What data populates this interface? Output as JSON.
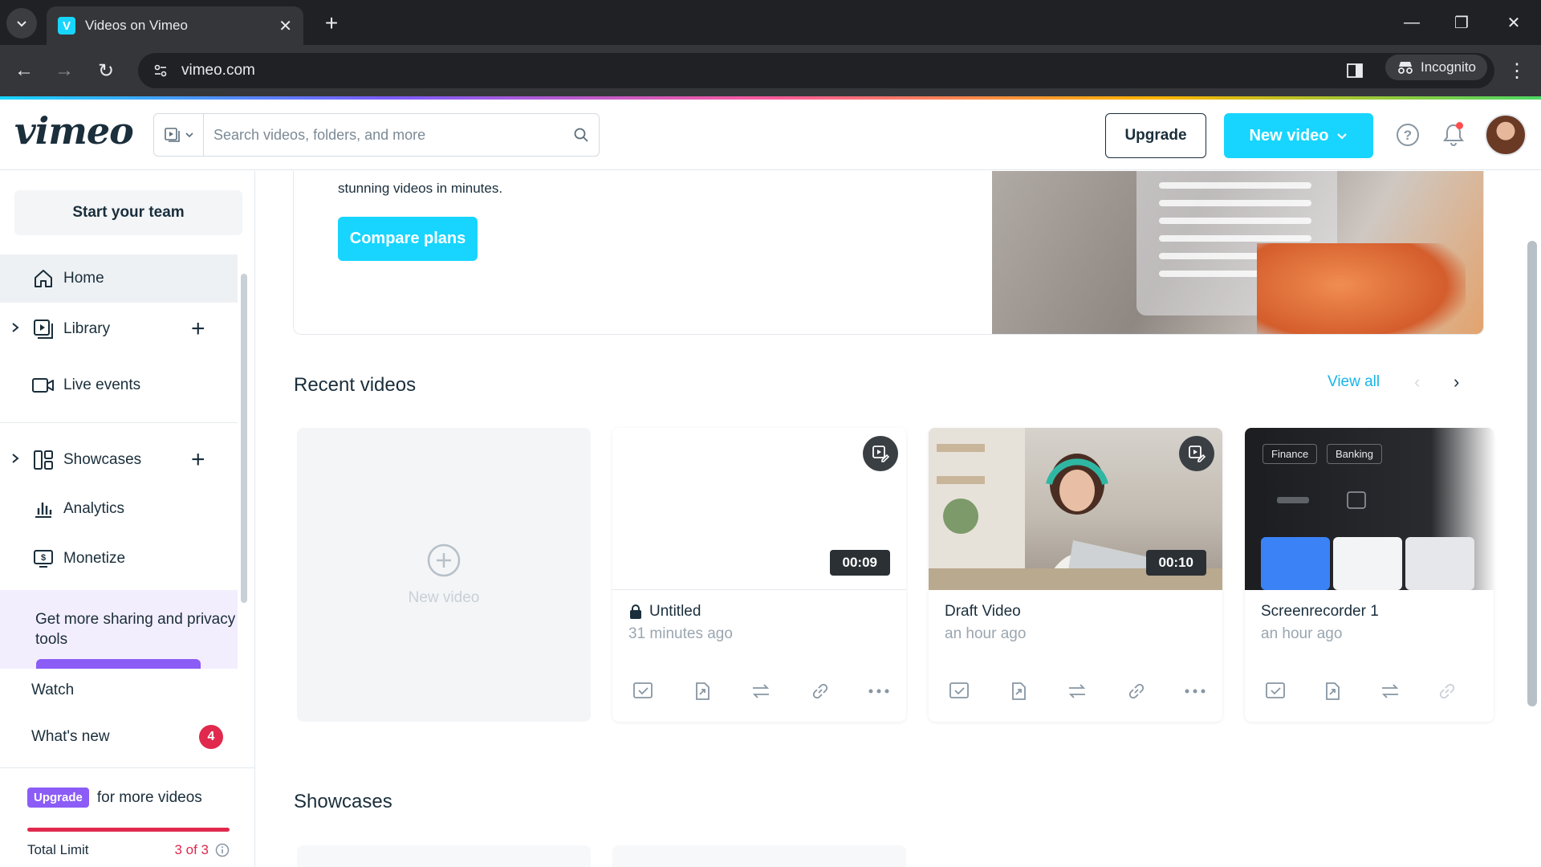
{
  "browser": {
    "tab_title": "Videos on Vimeo",
    "url": "vimeo.com",
    "incognito_label": "Incognito"
  },
  "header": {
    "logo": "vimeo",
    "search_placeholder": "Search videos, folders, and more",
    "upgrade_label": "Upgrade",
    "new_video_label": "New video"
  },
  "sidebar": {
    "start_team": "Start your team",
    "items": [
      {
        "label": "Home",
        "icon": "home-icon"
      },
      {
        "label": "Library",
        "icon": "library-icon"
      },
      {
        "label": "Live events",
        "icon": "camera-icon"
      },
      {
        "label": "Showcases",
        "icon": "showcase-icon"
      },
      {
        "label": "Analytics",
        "icon": "chart-icon"
      },
      {
        "label": "Monetize",
        "icon": "monetize-icon"
      }
    ],
    "promo_text": "Get more sharing and privacy tools",
    "watch": "Watch",
    "whats_new": "What's new",
    "whats_new_count": "4",
    "upgrade_chip": "Upgrade",
    "upgrade_text": "for more videos",
    "total_limit_label": "Total Limit",
    "total_limit_value": "3 of 3",
    "limit_used_fraction": 1.0
  },
  "banner": {
    "text": "stunning videos in minutes.",
    "compare_label": "Compare plans"
  },
  "recent": {
    "title": "Recent videos",
    "view_all": "View all",
    "new_video_label": "New video",
    "videos": [
      {
        "title": "Untitled",
        "time": "31 minutes ago",
        "duration": "00:09",
        "private": true
      },
      {
        "title": "Draft Video",
        "time": "an hour ago",
        "duration": "00:10",
        "private": false
      },
      {
        "title": "Screenrecorder 1",
        "time": "an hour ago",
        "duration": "",
        "private": false
      }
    ],
    "thumb3_chips": [
      "Finance",
      "Banking"
    ]
  },
  "showcases": {
    "title": "Showcases"
  },
  "colors": {
    "accent": "#17d5ff",
    "text": "#1a2e3b",
    "danger": "#e0294d",
    "purple": "#8b5cf6"
  }
}
